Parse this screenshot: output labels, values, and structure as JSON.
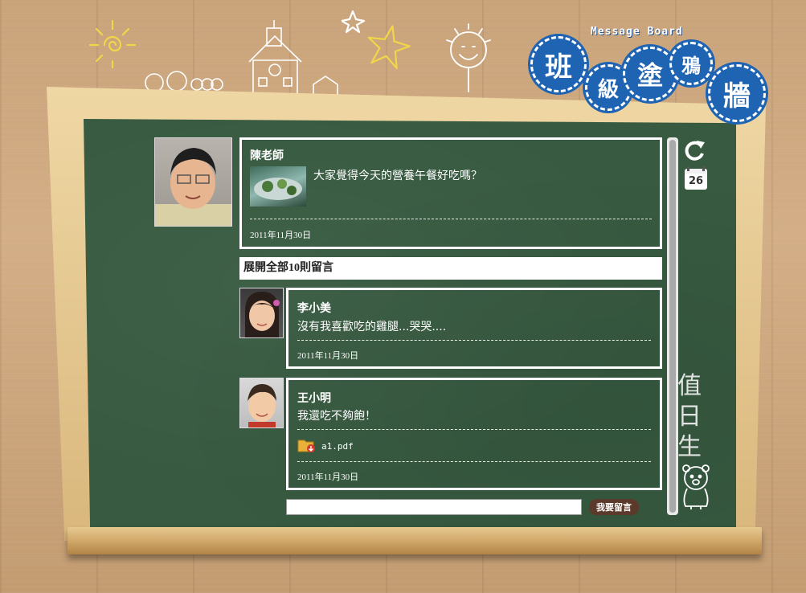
{
  "logo": {
    "subtitle": "Message Board",
    "chars": [
      "班",
      "級",
      "塗",
      "鴉",
      "牆"
    ]
  },
  "post": {
    "author": "陳老師",
    "message": "大家覺得今天的營養午餐好吃嗎？",
    "date": "2011年11月30日"
  },
  "expand_label": "展開全部10則留言",
  "comments": [
    {
      "author": "李小美",
      "message": "沒有我喜歡吃的雞腿...哭哭....",
      "date": "2011年11月30日"
    },
    {
      "author": "王小明",
      "message": "我還吃不夠飽！",
      "attachment": "a1.pdf",
      "date": "2011年11月30日"
    }
  ],
  "reply": {
    "placeholder": "",
    "button_label": "我要留言"
  },
  "side": {
    "calendar_day": "26",
    "chalk_text": "值日生"
  },
  "icons": [
    "sun-icon",
    "star-icon",
    "house-icon",
    "refresh-icon",
    "calendar-icon",
    "pdf-icon",
    "bear-icon"
  ],
  "colors": {
    "board": "#375a40",
    "logo_blue": "#1f63b3",
    "button": "#5b3a2b"
  }
}
